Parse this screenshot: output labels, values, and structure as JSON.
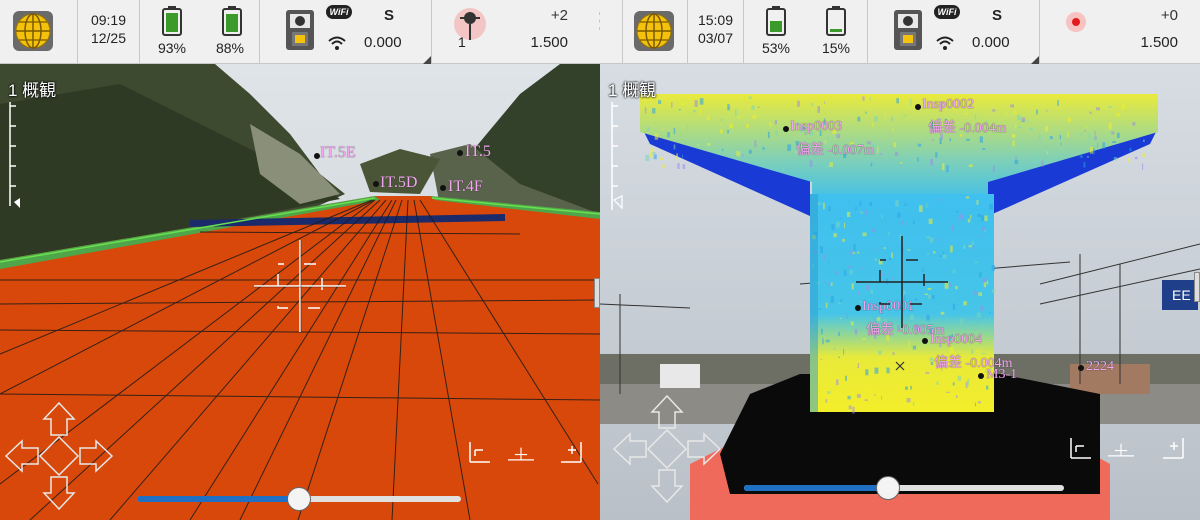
{
  "left": {
    "status": {
      "time": "09:19",
      "date": "12/25",
      "battery1_pct": "93%",
      "battery2_pct": "88%",
      "battery1_level": 0.93,
      "battery2_level": 0.88,
      "wifi_badge": "WiFi",
      "mode": "S",
      "instrument_value": "0.000",
      "target_number": "1",
      "target_offset": "+2",
      "target_height": "1.500"
    },
    "view_title": "1 概観",
    "labels": {
      "it5e": "IT.5E",
      "it5": "IT.5",
      "it5d": "IT.5D",
      "it4f": "IT.4F"
    },
    "zoom_level": 0.5
  },
  "more_menu": "⋮",
  "right": {
    "status": {
      "time": "15:09",
      "date": "03/07",
      "battery1_pct": "53%",
      "battery2_pct": "15%",
      "battery1_level": 0.53,
      "battery2_level": 0.15,
      "wifi_badge": "WiFi",
      "mode": "S",
      "instrument_value": "0.000",
      "target_offset": "+0",
      "target_height": "1.500"
    },
    "view_title": "1 概観",
    "labels": {
      "insp0002": "Insp0002",
      "insp0002_dev": "偏差 -0.004m",
      "insp0003": "Insp0003",
      "insp0003_dev": "偏差 -0.007m",
      "insp0001": "Insp0001",
      "insp0001_dev": "偏差 -0.005m",
      "insp0004": "Insp0004",
      "insp0004_dev": "偏差 -0.004m",
      "m3_1": "M3-1",
      "n2224": "2224",
      "sign_text": "EE"
    },
    "zoom_level": 0.45
  },
  "colors": {
    "statusbar_bg": "#f0f0f0",
    "road_surface": "#d8480a",
    "slider_fill": "#1f6fc4",
    "label_pink": "#f2a6f0",
    "pier_cyan": "#34c3ee",
    "pier_yellow": "#f3ee2a",
    "pier_blue": "#1a3ad6"
  },
  "icons": [
    "globe-icon",
    "battery-icon",
    "total-station-icon",
    "wifi-signal-icon",
    "prism-target-icon",
    "laser-dot-icon",
    "crosshair-icon",
    "dpad-icon",
    "view-left-icon",
    "view-front-icon",
    "view-top-icon",
    "scale-ruler-icon"
  ]
}
